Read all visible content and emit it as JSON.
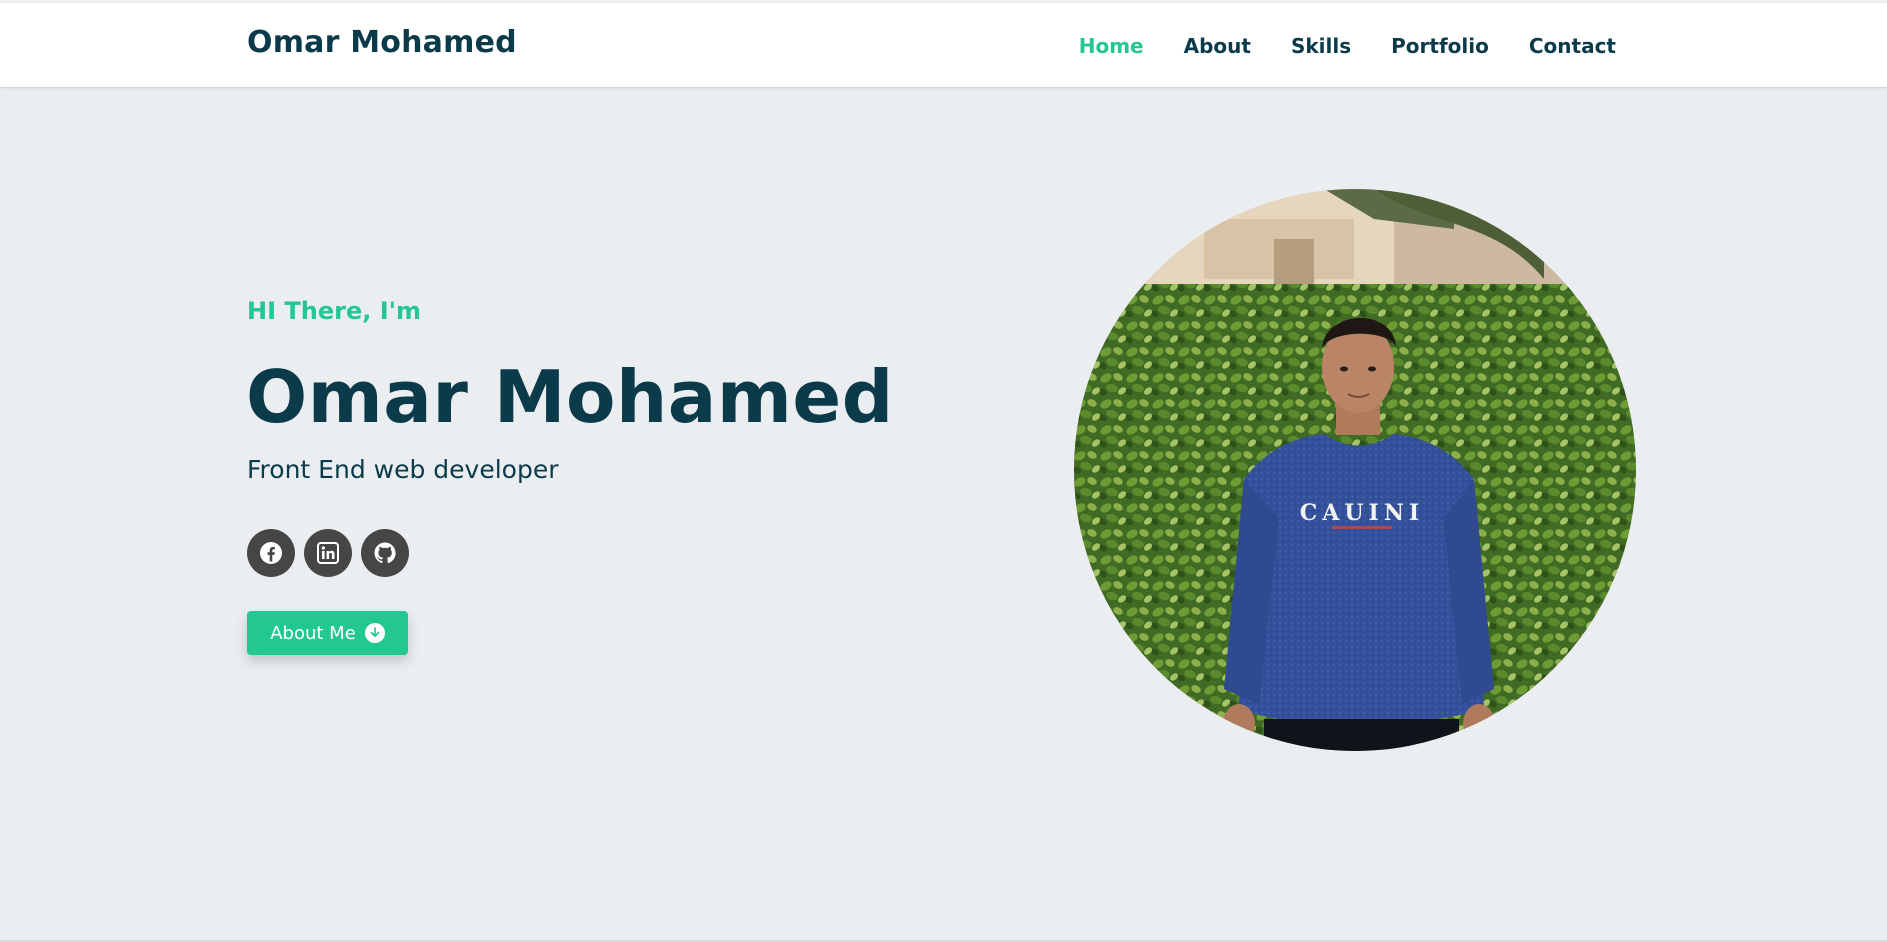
{
  "header": {
    "brand": "Omar Mohamed",
    "nav": [
      {
        "label": "Home",
        "active": true
      },
      {
        "label": "About",
        "active": false
      },
      {
        "label": "Skills",
        "active": false
      },
      {
        "label": "Portfolio",
        "active": false
      },
      {
        "label": "Contact",
        "active": false
      }
    ]
  },
  "hero": {
    "greeting": "HI There, I'm",
    "name": "Omar Mohamed",
    "role": "Front End web developer",
    "socials": [
      {
        "icon": "facebook-icon"
      },
      {
        "icon": "linkedin-icon"
      },
      {
        "icon": "github-icon"
      }
    ],
    "cta": {
      "label": "About Me",
      "icon": "arrow-down-circle-icon"
    },
    "portrait": {
      "alt": "portrait",
      "sweater_text": "CAUINI"
    }
  },
  "colors": {
    "accent": "#23c792",
    "dark": "#0b3a4a",
    "background": "#eaeef1",
    "social_bg": "#464646"
  }
}
